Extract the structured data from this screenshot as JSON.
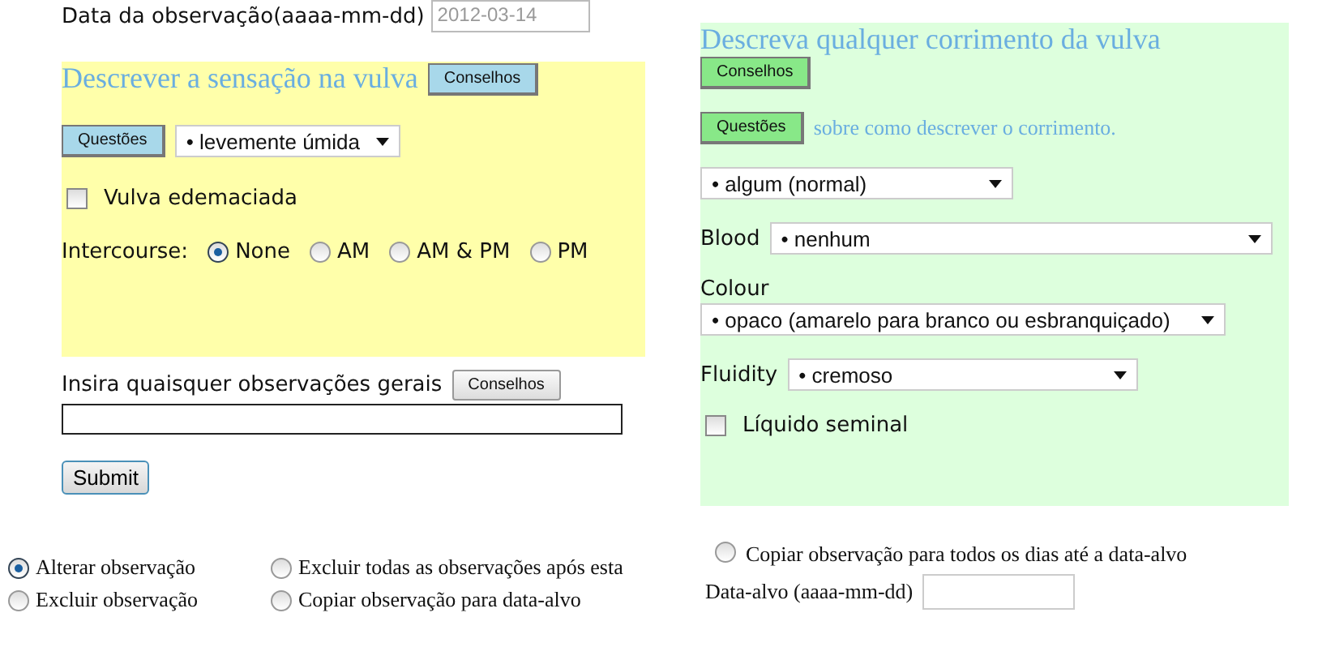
{
  "observation_date": {
    "label": "Data da observação(aaaa-mm-dd)",
    "value": "2012-03-14"
  },
  "sensation": {
    "title": "Descrever a sensação na vulva",
    "advice_button": "Conselhos",
    "questions_button": "Questões",
    "select": "• levemente úmida",
    "swollen": {
      "label": "Vulva edemaciada",
      "checked": false
    },
    "intercourse": {
      "label": "Intercourse:",
      "options": [
        {
          "label": "None",
          "selected": true
        },
        {
          "label": "AM",
          "selected": false
        },
        {
          "label": "AM & PM",
          "selected": false
        },
        {
          "label": "PM",
          "selected": false
        }
      ]
    }
  },
  "general": {
    "label": "Insira quaisquer observações gerais",
    "advice_button": "Conselhos"
  },
  "submit": "Submit",
  "discharge": {
    "title": "Descreva qualquer corrimento da vulva",
    "advice_button": "Conselhos",
    "questions_button": "Questões",
    "questions_note": "sobre como descrever o corrimento.",
    "amount": "• algum (normal)",
    "blood": {
      "label": "Blood",
      "value": "• nenhum"
    },
    "colour": {
      "label": "Colour",
      "value": "• opaco (amarelo para branco ou esbranquiçado)"
    },
    "fluidity": {
      "label": "Fluidity",
      "value": "• cremoso"
    },
    "seminal": {
      "label": "Líquido seminal",
      "checked": false
    }
  },
  "actions": [
    {
      "label": "Alterar observação",
      "selected": true
    },
    {
      "label": "Excluir todas as observações após esta",
      "selected": false
    },
    {
      "label": "Excluir observação",
      "selected": false
    },
    {
      "label": "Copiar observação para data-alvo",
      "selected": false
    },
    {
      "label": "Copiar observação para todos os dias até a data-alvo",
      "selected": false
    }
  ],
  "target_date": {
    "label": "Data-alvo (aaaa-mm-dd)"
  }
}
